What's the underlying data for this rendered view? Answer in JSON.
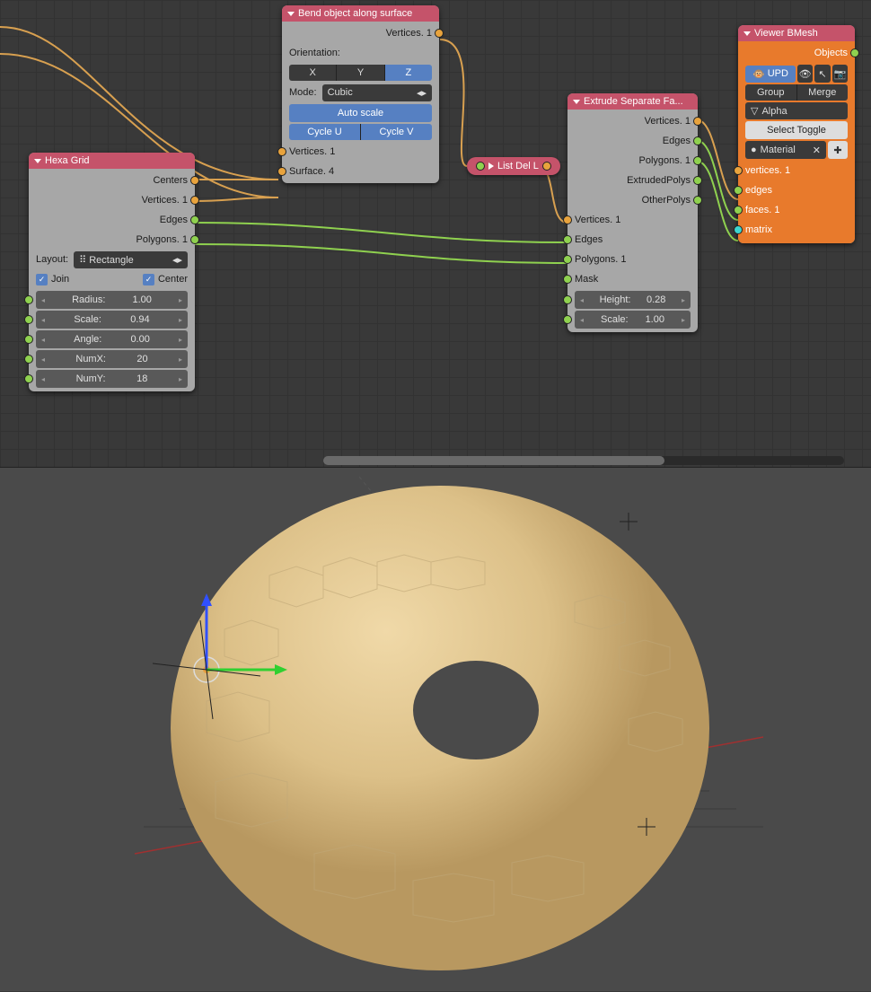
{
  "hexa": {
    "title": "Hexa Grid",
    "out": {
      "centers": "Centers",
      "vertices": "Vertices. 1",
      "edges": "Edges",
      "polygons": "Polygons. 1"
    },
    "layout_label": "Layout:",
    "layout_value": "Rectangle",
    "join": "Join",
    "center": "Center",
    "params": [
      {
        "name": "Radius:",
        "val": "1.00"
      },
      {
        "name": "Scale:",
        "val": "0.94"
      },
      {
        "name": "Angle:",
        "val": "0.00"
      },
      {
        "name": "NumX:",
        "val": "20"
      },
      {
        "name": "NumY:",
        "val": "18"
      }
    ]
  },
  "bend": {
    "title": "Bend object along surface",
    "out_vertices": "Vertices. 1",
    "orientation_label": "Orientation:",
    "axes": [
      "X",
      "Y",
      "Z"
    ],
    "mode_label": "Mode:",
    "mode_value": "Cubic",
    "auto_scale": "Auto scale",
    "cycle_u": "Cycle U",
    "cycle_v": "Cycle V",
    "in_vertices": "Vertices. 1",
    "in_surface": "Surface. 4"
  },
  "listdel": {
    "title": "List Del L"
  },
  "extrude": {
    "title": "Extrude Separate Fa...",
    "out": {
      "vertices": "Vertices. 1",
      "edges": "Edges",
      "polygons": "Polygons. 1",
      "extruded": "ExtrudedPolys",
      "other": "OtherPolys"
    },
    "in": {
      "vertices": "Vertices. 1",
      "edges": "Edges",
      "polygons": "Polygons. 1",
      "mask": "Mask"
    },
    "height_label": "Height:",
    "height_val": "0.28",
    "scale_label": "Scale:",
    "scale_val": "1.00"
  },
  "viewer": {
    "title": "Viewer BMesh",
    "objects": "Objects",
    "upd": "UPD",
    "group": "Group",
    "merge": "Merge",
    "alpha": "Alpha",
    "select_toggle": "Select Toggle",
    "material": "Material",
    "in": {
      "vertices": "vertices. 1",
      "edges": "edges",
      "faces": "faces. 1",
      "matrix": "matrix"
    }
  }
}
